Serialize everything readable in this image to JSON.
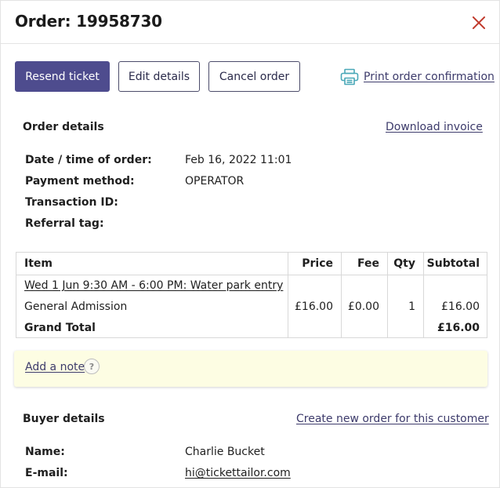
{
  "header": {
    "title": "Order: 19958730"
  },
  "toolbar": {
    "resend_label": "Resend ticket",
    "edit_label": "Edit details",
    "cancel_label": "Cancel order",
    "print_label": "Print order confirmation"
  },
  "order_details": {
    "title": "Order details",
    "download_label": "Download invoice",
    "fields": [
      {
        "label": "Date / time of order:",
        "value": "Feb 16, 2022 11:01"
      },
      {
        "label": "Payment method:",
        "value": "OPERATOR"
      },
      {
        "label": "Transaction ID:",
        "value": ""
      },
      {
        "label": "Referral tag:",
        "value": ""
      }
    ]
  },
  "table": {
    "headers": {
      "item": "Item",
      "price": "Price",
      "fee": "Fee",
      "qty": "Qty",
      "subtotal": "Subtotal"
    },
    "event_link": "Wed 1 Jun 9:30 AM - 6:00 PM: Water park entry",
    "row": {
      "item": "General Admission",
      "price": "£16.00",
      "fee": "£0.00",
      "qty": "1",
      "subtotal": "£16.00"
    },
    "total": {
      "label": "Grand Total",
      "value": "£16.00"
    }
  },
  "note": {
    "link_label": "Add a note",
    "help_symbol": "?"
  },
  "buyer": {
    "title": "Buyer details",
    "create_order_label": "Create new order for this customer",
    "name_label": "Name:",
    "name_value": "Charlie Bucket",
    "email_label": "E-mail:",
    "email_value": "hi@tickettailor.com"
  },
  "colors": {
    "primary": "#4e4c8e",
    "close": "#c0392b",
    "note_bg": "#fdfde3",
    "link": "#3d3b6b",
    "print_icon": "#4aa8b8"
  }
}
